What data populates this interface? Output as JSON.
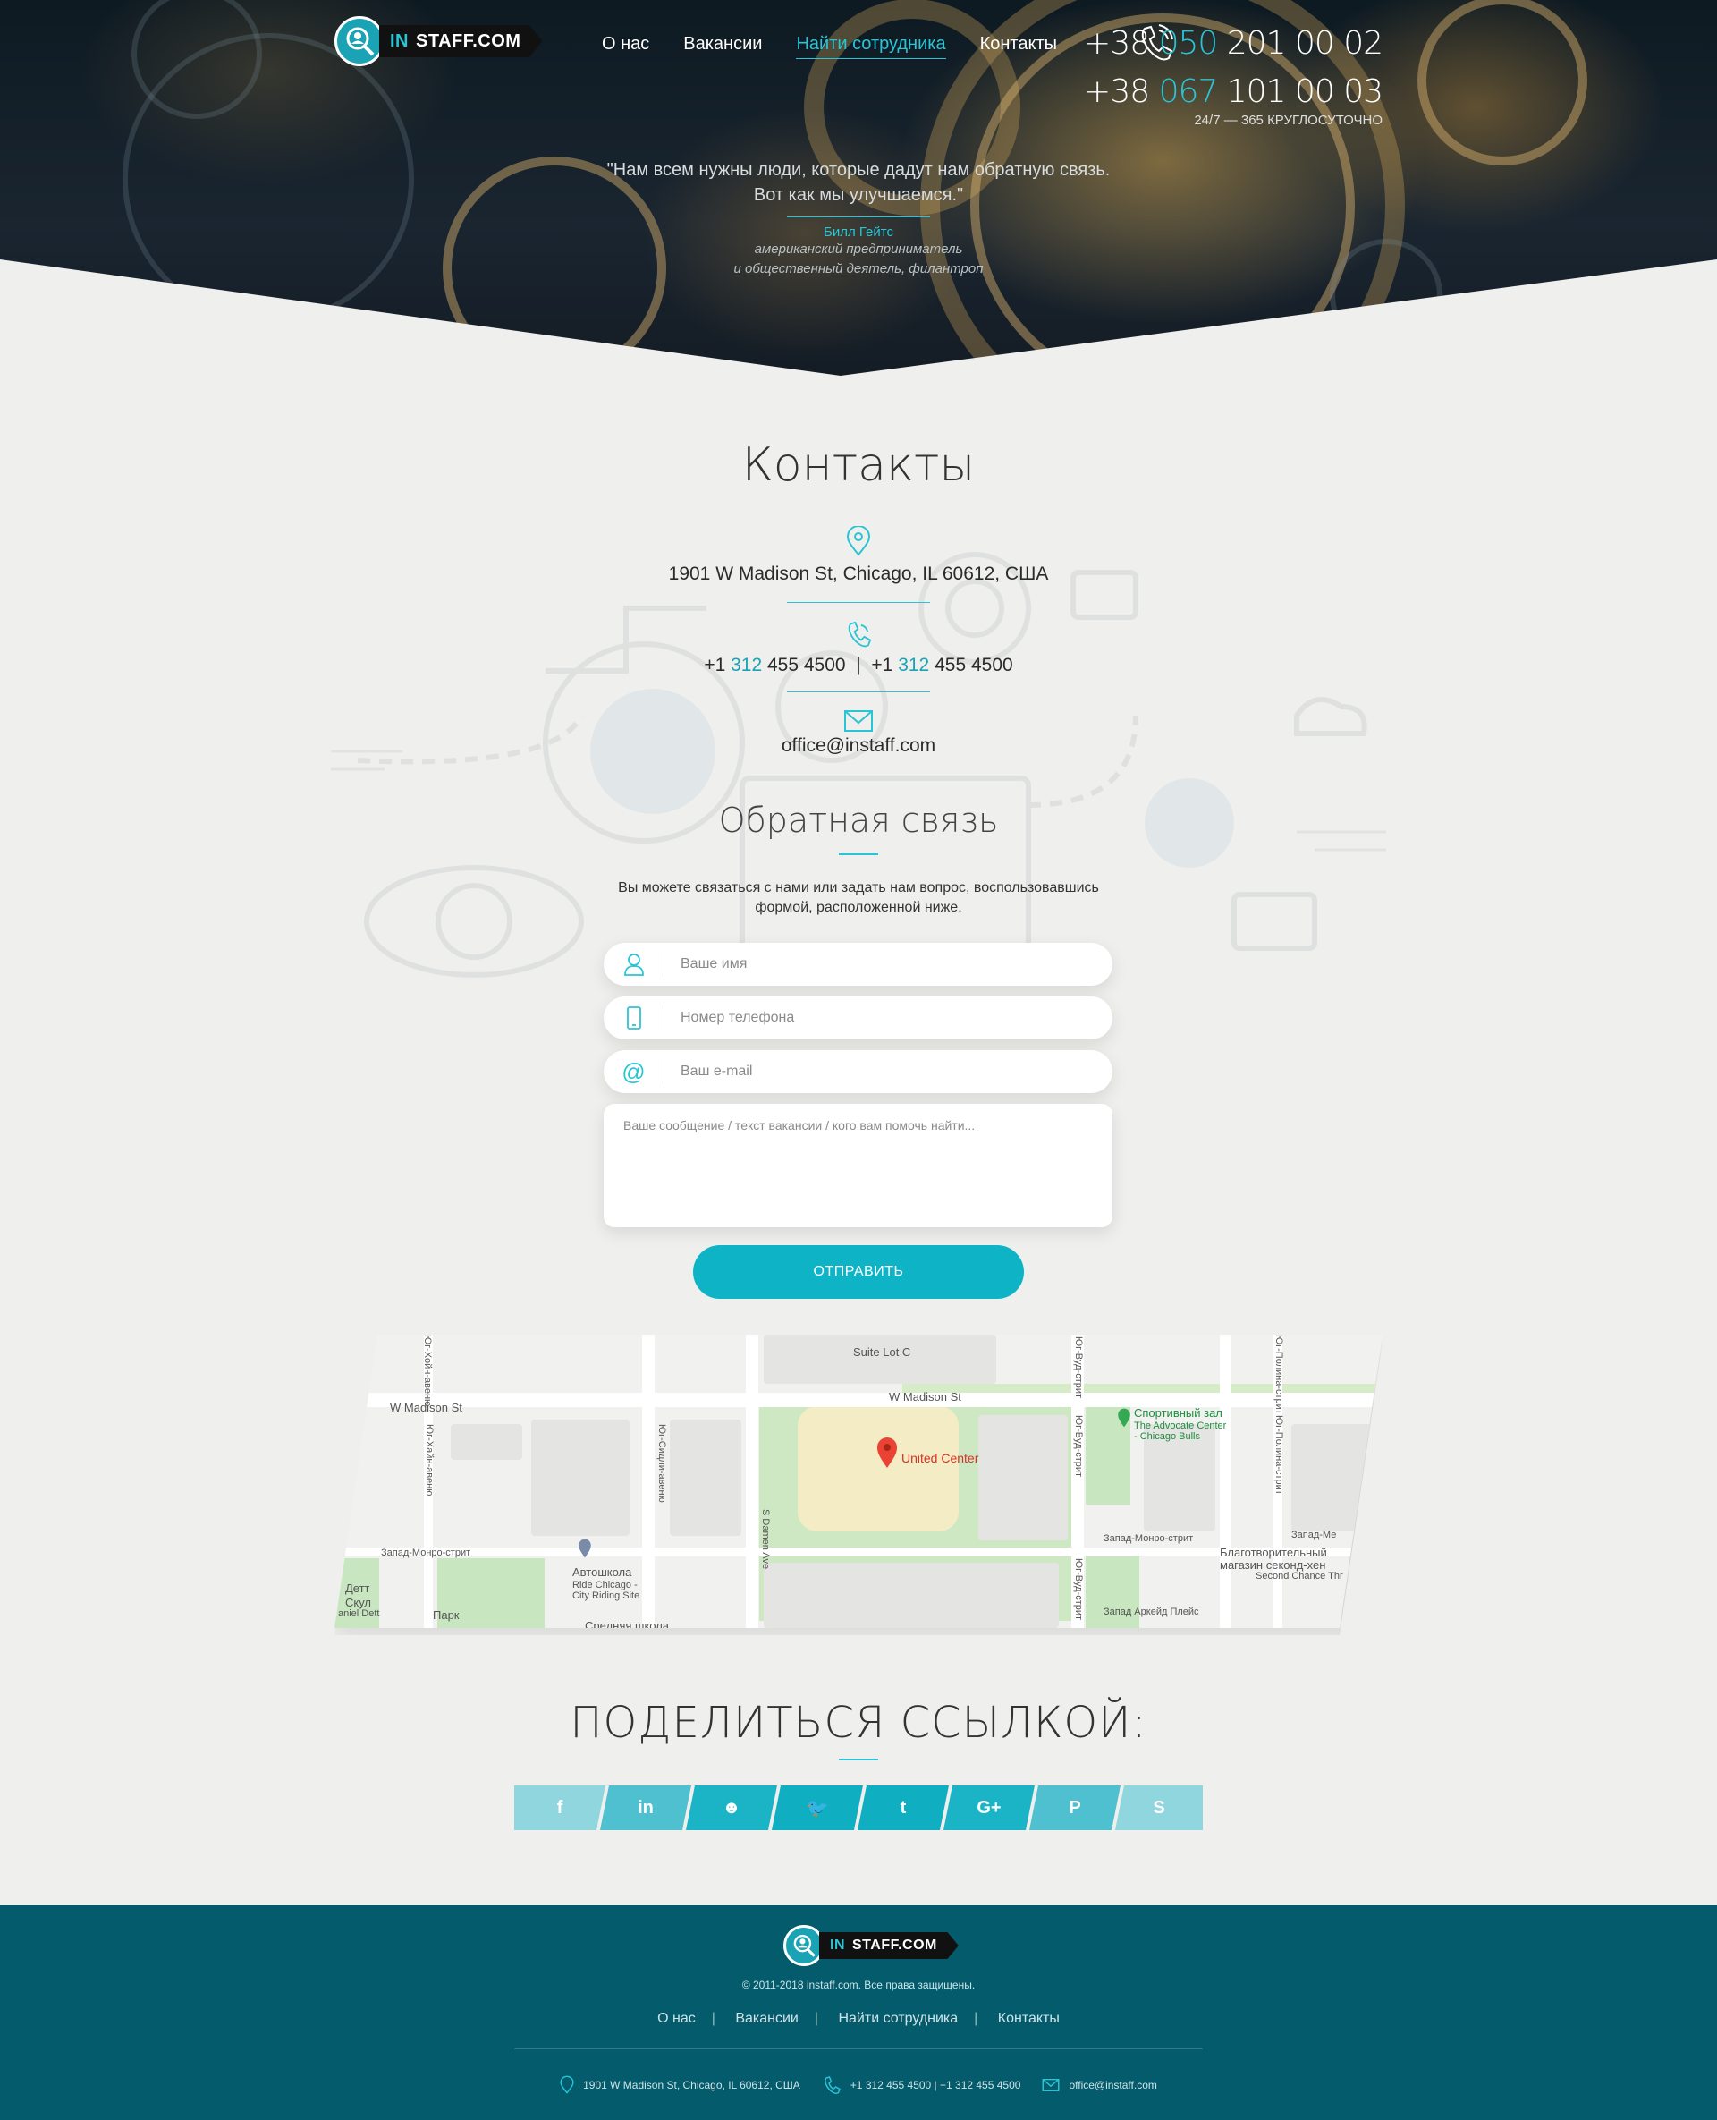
{
  "header": {
    "logo_prefix": "IN",
    "logo_text": "STAFF.COM",
    "nav": [
      {
        "label": "О нас",
        "active": false
      },
      {
        "label": "Вакансии",
        "active": false
      },
      {
        "label": "Найти сотрудника",
        "active": true
      },
      {
        "label": "Контакты",
        "active": false
      }
    ],
    "phone1": {
      "prefix": "+38",
      "code": "050",
      "number": "201 00 02"
    },
    "phone2": {
      "prefix": "+38",
      "code": "067",
      "number": "101 00 03"
    },
    "hours": "24/7 — 365 КРУГЛОСУТОЧНО"
  },
  "quote": {
    "line1": "\"Нам всем нужны люди, которые дадут нам обратную связь.",
    "line2": "Вот как мы улучшаемся.\"",
    "author": "Билл Гейтс",
    "role1": "американский предприниматель",
    "role2": "и общественный деятель, филантроп"
  },
  "contacts": {
    "title": "Контакты",
    "address": "1901 W Madison St, Chicago, IL 60612, США",
    "phone_a_prefix": "+1",
    "phone_a_code": "312",
    "phone_a_number": "455 4500",
    "phone_sep": "|",
    "phone_b_prefix": "+1",
    "phone_b_code": "312",
    "phone_b_number": "455 4500",
    "email": "office@instaff.com"
  },
  "feedback": {
    "title": "Обратная связь",
    "desc1": "Вы можете связаться с нами или задать нам вопрос, воспользовавшись",
    "desc2": "формой, расположенной ниже.",
    "name_placeholder": "Ваше имя",
    "phone_placeholder": "Номер телефона",
    "email_placeholder": "Ваш e-mail",
    "message_placeholder": "Ваше сообщение / текст вакансии / кого вам помочь найти...",
    "send_label": "ОТПРАВИТЬ"
  },
  "map": {
    "labels": {
      "madison_left": "W Madison St",
      "madison_right": "W Madison St",
      "suite_lot": "Suite Lot C",
      "united_center": "United Center",
      "damen": "S Damen Ave",
      "hoyne": "Юг-Хойн-авеню",
      "hoyne2": "Юг-Хайн-авеню",
      "seeley": "Юг-Сидли-авеню",
      "wood": "Юг-Вуд-стрит",
      "wood2": "Юг-Вуд-стрит",
      "wood3": "Юг-Вуд-стрит",
      "paulina": "Юг-Полина-стрит",
      "paulina2": "Юг-Полина-стрит",
      "monroe_left": "Запад-Монро-стрит",
      "monroe_mid": "Запад-Монро-стрит",
      "monroe_right": "Запад-Ме",
      "arcade": "Запад Аркейд Плейс",
      "gym1": "Спортивный зал",
      "gym2": "The Advocate Center",
      "gym3": "- Chicago Bulls",
      "auto1": "Автошкола",
      "auto2": "Ride Chicago -",
      "auto3": "City Riding Site",
      "charity1": "Благотворительный",
      "charity2": "магазин секонд-хен",
      "charity3": "Second Chance Thr",
      "school1": "Детт",
      "school2": "Скул",
      "school3": "aniel Dett",
      "park": "Парк",
      "middle_school": "Средняя школа"
    }
  },
  "share": {
    "title": "ПОДЕЛИТЬСЯ ССЫЛКОЙ:",
    "buttons": [
      {
        "icon": "facebook-icon",
        "glyph": "f",
        "color": "#8fd6df"
      },
      {
        "icon": "linkedin-icon",
        "glyph": "in",
        "color": "#4fc0cf"
      },
      {
        "icon": "reddit-icon",
        "glyph": "☻",
        "color": "#1ab4c6"
      },
      {
        "icon": "twitter-icon",
        "glyph": "🐦",
        "color": "#10aec1"
      },
      {
        "icon": "tumblr-icon",
        "glyph": "t",
        "color": "#10aec1"
      },
      {
        "icon": "google-plus-icon",
        "glyph": "G+",
        "color": "#1ab4c6"
      },
      {
        "icon": "pinterest-icon",
        "glyph": "P",
        "color": "#4fc0cf"
      },
      {
        "icon": "skype-icon",
        "glyph": "S",
        "color": "#8fd6df"
      }
    ]
  },
  "footer": {
    "copyright": "© 2011-2018 instaff.com. Все права защищены.",
    "nav": [
      "О нас",
      "Вакансии",
      "Найти сотрудника",
      "Контакты"
    ],
    "address": "1901 W Madison St, Chicago, IL 60612, США",
    "phones": "+1 312 455 4500  |  +1 312 455 4500",
    "email": "office@instaff.com"
  },
  "colors": {
    "accent": "#29c5d6",
    "button": "#0fb3c6",
    "footer": "#035b6c",
    "page": "#efefed"
  }
}
